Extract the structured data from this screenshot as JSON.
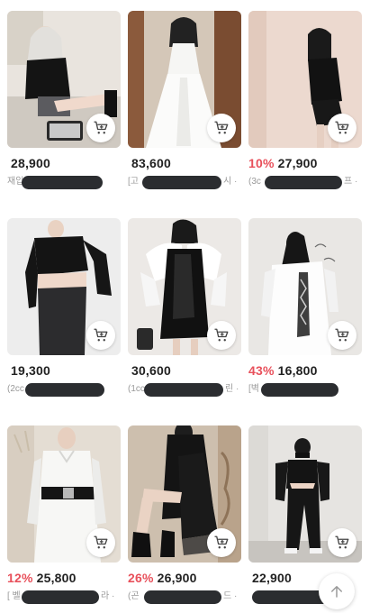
{
  "products": [
    {
      "discount": "",
      "price": "28,900",
      "store_prefix": "재입",
      "store_suffix": ""
    },
    {
      "discount": "",
      "price": "83,600",
      "store_prefix": "[고",
      "store_suffix": "시 ·"
    },
    {
      "discount": "10%",
      "price": "27,900",
      "store_prefix": "(3c",
      "store_suffix": "프 ·"
    },
    {
      "discount": "",
      "price": "19,300",
      "store_prefix": "(2cc",
      "store_suffix": ""
    },
    {
      "discount": "",
      "price": "30,600",
      "store_prefix": "(1cc",
      "store_suffix": "린 ·"
    },
    {
      "discount": "43%",
      "price": "16,800",
      "store_prefix": "[벽",
      "store_suffix": ""
    },
    {
      "discount": "12%",
      "price": "25,800",
      "store_prefix": "[ 벨",
      "store_suffix": "라 ·"
    },
    {
      "discount": "26%",
      "price": "26,900",
      "store_prefix": "(곤",
      "store_suffix": "드 ·"
    },
    {
      "discount": "",
      "price": "22,900",
      "store_prefix": "",
      "store_suffix": ""
    }
  ],
  "icons": {
    "cart": "shopping-cart-icon",
    "scroll_top": "arrow-up-icon"
  },
  "colors": {
    "discount": "#e8505b",
    "cart_icon": "#444444",
    "redaction": "#2b2d30"
  }
}
